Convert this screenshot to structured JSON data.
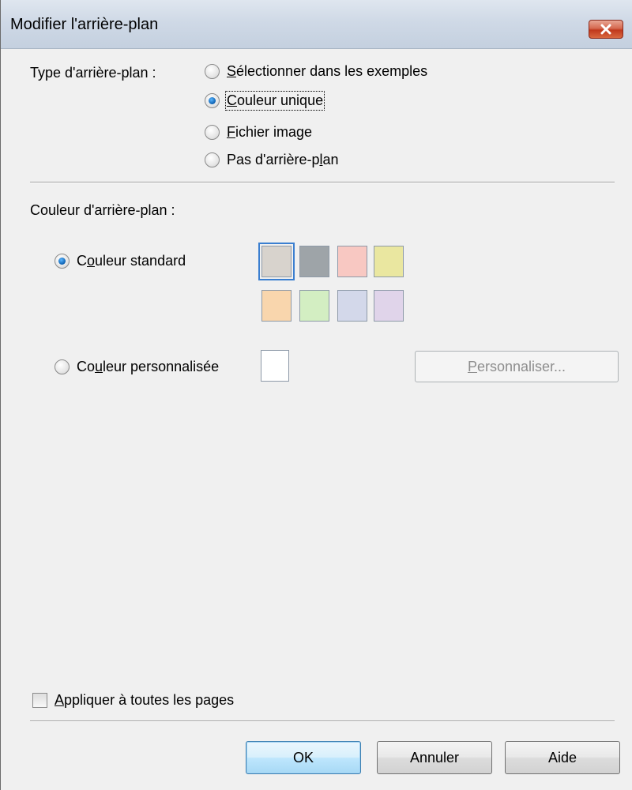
{
  "window": {
    "title": "Modifier l'arrière-plan"
  },
  "type_section": {
    "label": "Type d'arrière-plan :",
    "options": [
      {
        "mnemonic": "S",
        "rest": "électionner dans les exemples",
        "selected": false
      },
      {
        "mnemonic": "C",
        "rest": "ouleur unique",
        "selected": true
      },
      {
        "mnemonic": "F",
        "rest": "ichier image",
        "selected": false
      },
      {
        "prefix": "Pas d'arrière-p",
        "mnemonic": "l",
        "rest": "an",
        "selected": false
      }
    ]
  },
  "color_section": {
    "label": "Couleur d'arrière-plan :",
    "standard": {
      "prefix": "C",
      "mnemonic": "o",
      "rest": "uleur standard",
      "selected": true
    },
    "custom": {
      "prefix": "Co",
      "mnemonic": "u",
      "rest": "leur personnalisée",
      "selected": false
    },
    "swatches": [
      "#d8d3cd",
      "#9ea4a8",
      "#f8c8c2",
      "#eae7a0",
      "#f9d6ad",
      "#d3eec2",
      "#d3d8ea",
      "#e0d4ea"
    ],
    "selected_swatch": 0,
    "custom_color": "#ffffff",
    "customize_button": {
      "mnemonic": "P",
      "rest": "ersonnaliser..."
    }
  },
  "apply_all": {
    "mnemonic": "A",
    "rest": "ppliquer à toutes les pages",
    "checked": false
  },
  "buttons": {
    "ok": "OK",
    "cancel": "Annuler",
    "help": "Aide"
  }
}
